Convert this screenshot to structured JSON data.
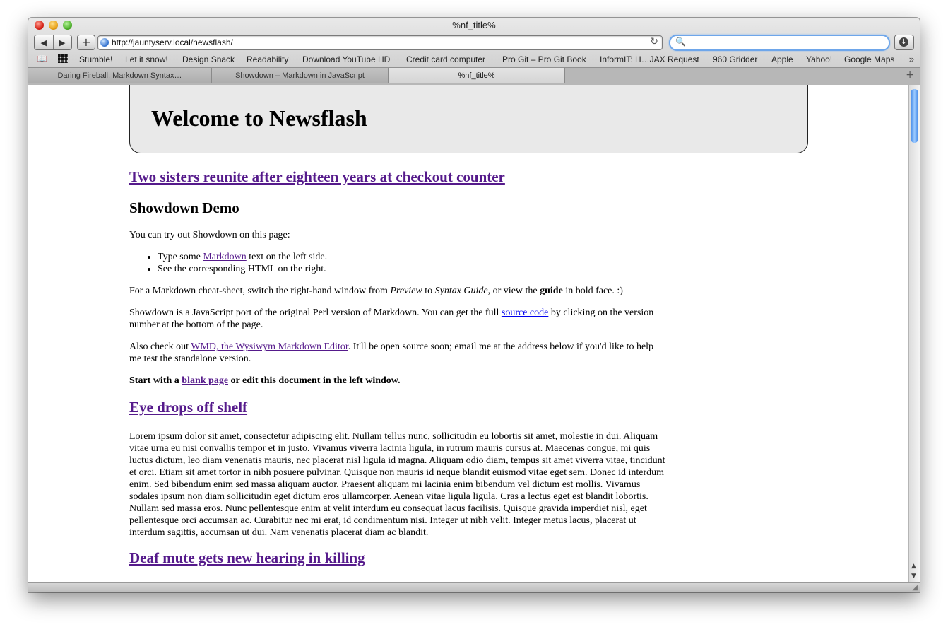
{
  "window": {
    "title": "%nf_title%"
  },
  "toolbar": {
    "back_glyph": "◀",
    "forward_glyph": "▶",
    "add_glyph": "+",
    "url": "http://jauntyserv.local/newsflash/",
    "reload_glyph": "↻",
    "search_value": "",
    "search_glyph": "🔍",
    "download_glyph": "↓"
  },
  "bookmarks": [
    "Stumble!",
    "Let it snow!",
    "Design Snack",
    "Readability",
    "Download YouTube HD",
    "Credit card computer",
    "Pro Git – Pro Git Book",
    "InformIT: H…JAX Request",
    "960 Gridder",
    "Apple",
    "Yahoo!",
    "Google Maps"
  ],
  "bookmarks_more": "»",
  "tabs": [
    {
      "label": "Daring Fireball: Markdown Syntax…"
    },
    {
      "label": "Showdown – Markdown in JavaScript"
    },
    {
      "label": "%nf_title%"
    }
  ],
  "tab_add": "+",
  "page": {
    "header": "Welcome to Newsflash",
    "articles": [
      {
        "title": "Two sisters reunite after eighteen years at checkout counter",
        "subheading": "Showdown Demo",
        "intro": "You can try out Showdown on this page:",
        "list": [
          {
            "pre": "Type some ",
            "link": "Markdown",
            "post": " text on the left side."
          },
          {
            "pre": "See the corresponding HTML on the right.",
            "link": "",
            "post": ""
          }
        ],
        "cheatsheet": {
          "pre": "For a Markdown cheat-sheet, switch the right-hand window from ",
          "em1": "Preview",
          "mid1": " to ",
          "em2": "Syntax Guide",
          "mid2": ", or view the ",
          "strong": "guide",
          "post": " in bold face. :)"
        },
        "port": {
          "pre": "Showdown is a JavaScript port of the original Perl version of Markdown. You can get the full ",
          "link": "source code",
          "post": " by clicking on the version number at the bottom of the page."
        },
        "wmd": {
          "pre": "Also check out ",
          "link": "WMD, the Wysiwym Markdown Editor",
          "post": ". It'll be open source soon; email me at the address below if you'd like to help me test the standalone version."
        },
        "start": {
          "pre": "Start with a ",
          "link": "blank page",
          "post": " or edit this document in the left window."
        }
      },
      {
        "title": "Eye drops off shelf",
        "body": "Lorem ipsum dolor sit amet, consectetur adipiscing elit. Nullam tellus nunc, sollicitudin eu lobortis sit amet, molestie in dui. Aliquam vitae urna eu nisi convallis tempor et in justo. Vivamus viverra lacinia ligula, in rutrum mauris cursus at. Maecenas congue, mi quis luctus dictum, leo diam venenatis mauris, nec placerat nisl ligula id magna. Aliquam odio diam, tempus sit amet viverra vitae, tincidunt et orci. Etiam sit amet tortor in nibh posuere pulvinar. Quisque non mauris id neque blandit euismod vitae eget sem. Donec id interdum enim. Sed bibendum enim sed massa aliquam auctor. Praesent aliquam mi lacinia enim bibendum vel dictum est mollis. Vivamus sodales ipsum non diam sollicitudin eget dictum eros ullamcorper. Aenean vitae ligula ligula. Cras a lectus eget est blandit lobortis. Nullam sed massa eros. Nunc pellentesque enim at velit interdum eu consequat lacus facilisis. Quisque gravida imperdiet nisl, eget pellentesque orci accumsan ac. Curabitur nec mi erat, id condimentum nisi. Integer ut nibh velit. Integer metus lacus, placerat ut interdum sagittis, accumsan ut dui. Nam venenatis placerat diam ac blandit."
      },
      {
        "title": "Deaf mute gets new hearing in killing"
      }
    ]
  },
  "scrollbar": {
    "up": "▲",
    "down": "▼",
    "position": 0.0
  },
  "statusbar": {
    "grip": "◢"
  },
  "colors": {
    "visited_link": "#551a8b",
    "link": "#0000ee",
    "header_bg": "#e9e9e9",
    "search_focus": "#6ea6ea"
  }
}
